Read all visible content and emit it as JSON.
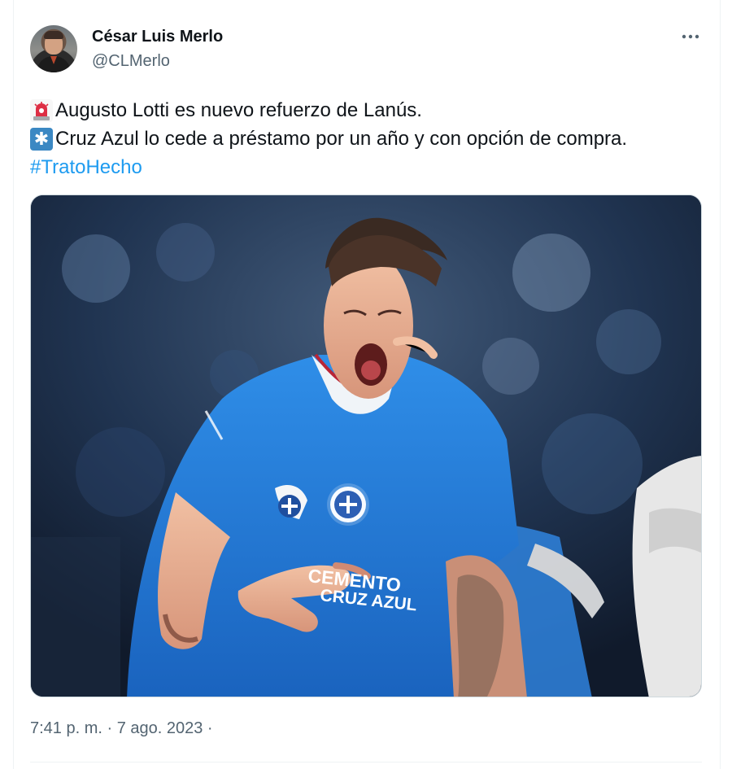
{
  "author": {
    "display_name": "César Luis Merlo",
    "handle": "@CLMerlo"
  },
  "tweet": {
    "lines": [
      {
        "emoji": "siren-icon",
        "text": "Augusto Lotti es nuevo refuerzo de Lanús."
      },
      {
        "emoji": "snowflake-icon",
        "text": "Cruz Azul lo cede a préstamo por un año y con opción de compra."
      }
    ],
    "hashtag": "#TratoHecho",
    "timestamp": "7:41 p. m. · 7 ago. 2023 ·"
  },
  "media": {
    "description": "photo",
    "jersey_sponsor": "CEMENTO",
    "jersey_sponsor_line2": "CRUZ AZUL"
  },
  "colors": {
    "link": "#1d9bf0",
    "secondary_text": "#536471",
    "jersey_blue": "#1f79d8"
  },
  "menu": {
    "more_label": "More"
  }
}
